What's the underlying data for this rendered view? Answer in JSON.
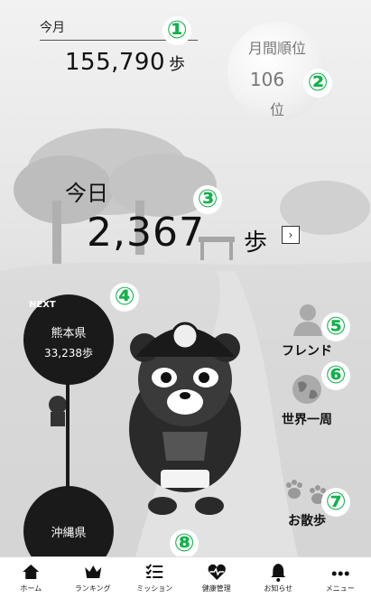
{
  "month": {
    "label": "今月",
    "value": "155,790",
    "unit": "歩"
  },
  "ranking": {
    "title": "月間順位",
    "value": "106",
    "unit": "位"
  },
  "today": {
    "label": "今日",
    "value": "2,367",
    "unit": "歩",
    "detail_icon": "chevron-right-icon"
  },
  "route": {
    "next_tag": "NEXT",
    "next_prefecture": "熊本県",
    "next_steps": "33,238歩",
    "current_prefecture": "沖縄県"
  },
  "side_buttons": [
    {
      "label": "フレンド",
      "icon": "friend-icon"
    },
    {
      "label": "世界一周",
      "icon": "globe-icon"
    },
    {
      "label": "お散歩",
      "icon": "paw-icon"
    }
  ],
  "callouts": [
    "①",
    "②",
    "③",
    "④",
    "⑤",
    "⑥",
    "⑦",
    "⑧"
  ],
  "callout_color": "#12b24c",
  "nav": [
    {
      "label": "ホーム",
      "icon": "home-icon"
    },
    {
      "label": "ランキング",
      "icon": "crown-icon"
    },
    {
      "label": "ミッション",
      "icon": "checklist-icon"
    },
    {
      "label": "健康管理",
      "icon": "heart-pulse-icon"
    },
    {
      "label": "お知らせ",
      "icon": "bell-icon"
    },
    {
      "label": "メニュー",
      "icon": "more-icon"
    }
  ]
}
